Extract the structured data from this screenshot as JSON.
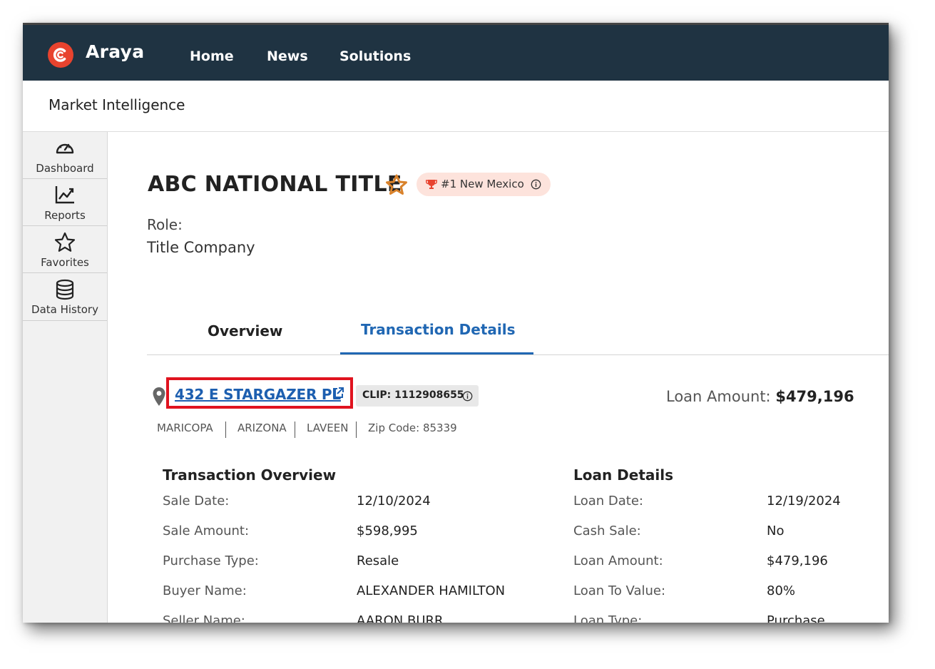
{
  "app": {
    "logo_text": "Araya",
    "nav": [
      "Home",
      "News",
      "Solutions"
    ],
    "section_title": "Market Intelligence",
    "brand_color": "#e8432e",
    "topbar_color": "#1f3342",
    "accent_color": "#2067b3"
  },
  "sidebar": {
    "items": [
      {
        "label": "Dashboard",
        "icon": "gauge-icon"
      },
      {
        "label": "Reports",
        "icon": "chart-line-icon"
      },
      {
        "label": "Favorites",
        "icon": "star-outline-icon"
      },
      {
        "label": "Data History",
        "icon": "database-icon"
      }
    ]
  },
  "company": {
    "name": "ABC NATIONAL TITLE",
    "rank_badge": "#1 New Mexico",
    "role_label": "Role:",
    "role_value": "Title Company"
  },
  "tabs": {
    "overview": "Overview",
    "details": "Transaction Details",
    "active": "Transaction Details"
  },
  "property": {
    "address": "432 E STARGAZER PL",
    "clip": "CLIP: 1112908655",
    "loan_amount_label": "Loan Amount:",
    "loan_amount_value": "$479,196",
    "county": "MARICOPA",
    "state": "ARIZONA",
    "city": "LAVEEN",
    "zip": "Zip Code: 85339"
  },
  "transaction_overview": {
    "title": "Transaction Overview",
    "rows": [
      {
        "label": "Sale Date:",
        "value": "12/10/2024"
      },
      {
        "label": "Sale Amount:",
        "value": "$598,995"
      },
      {
        "label": "Purchase Type:",
        "value": "Resale"
      },
      {
        "label": "Buyer Name:",
        "value": "ALEXANDER HAMILTON"
      },
      {
        "label": "Seller Name:",
        "value": "AARON BURR"
      }
    ]
  },
  "loan_details": {
    "title": "Loan Details",
    "rows": [
      {
        "label": "Loan Date:",
        "value": "12/19/2024"
      },
      {
        "label": "Cash Sale:",
        "value": "No"
      },
      {
        "label": "Loan Amount:",
        "value": "$479,196"
      },
      {
        "label": "Loan To Value:",
        "value": "80%"
      },
      {
        "label": "Loan Type:",
        "value": "Purchase"
      }
    ]
  }
}
